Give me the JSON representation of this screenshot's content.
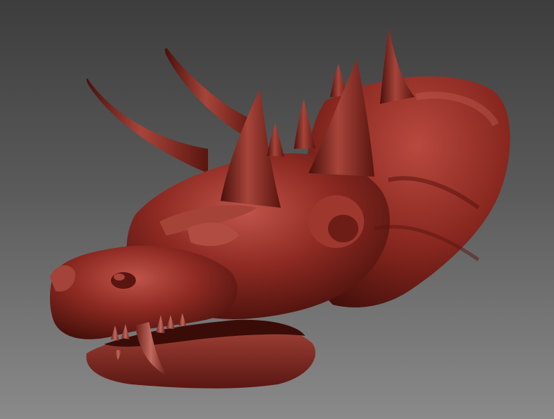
{
  "scene": {
    "background_top": "#3d3d3d",
    "background_bottom": "#8a8a8a",
    "material_color": "#8e2a22",
    "material_highlight": "#c0544a",
    "material_shadow": "#3e0c08",
    "horn_color": "#7a1f18",
    "tooth_color": "#a9463c"
  }
}
